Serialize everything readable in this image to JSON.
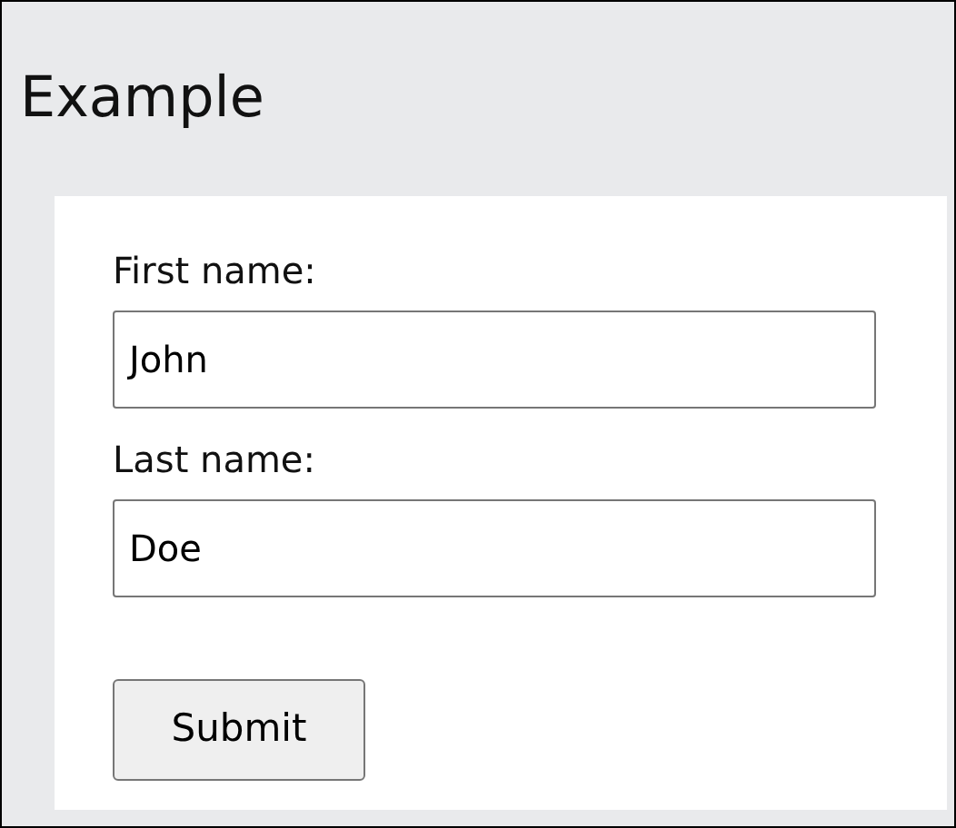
{
  "title": "Example",
  "fields": [
    {
      "label": "First name:",
      "value": "John"
    },
    {
      "label": "Last name:",
      "value": "Doe"
    }
  ],
  "submit": "Submit"
}
